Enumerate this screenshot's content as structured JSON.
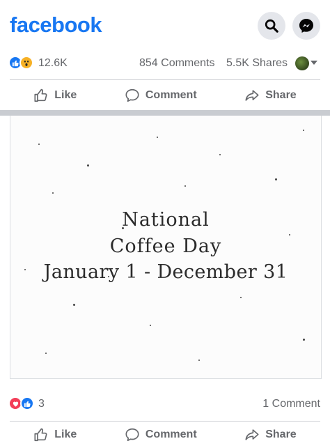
{
  "header": {
    "logo": "facebook"
  },
  "post": {
    "reaction_count": "12.6K",
    "comments_count": "854 Comments",
    "shares_count": "5.5K Shares"
  },
  "actions": {
    "like": "Like",
    "comment": "Comment",
    "share": "Share"
  },
  "image": {
    "line1": "National",
    "line2": "Coffee Day",
    "line3": "January 1 - December 31"
  },
  "footer_stats": {
    "reaction_count": "3",
    "comments": "1 Comment"
  },
  "colors": {
    "brand": "#1877f2",
    "love": "#f33e58",
    "wow": "#f7b125",
    "muted": "#65676b"
  }
}
